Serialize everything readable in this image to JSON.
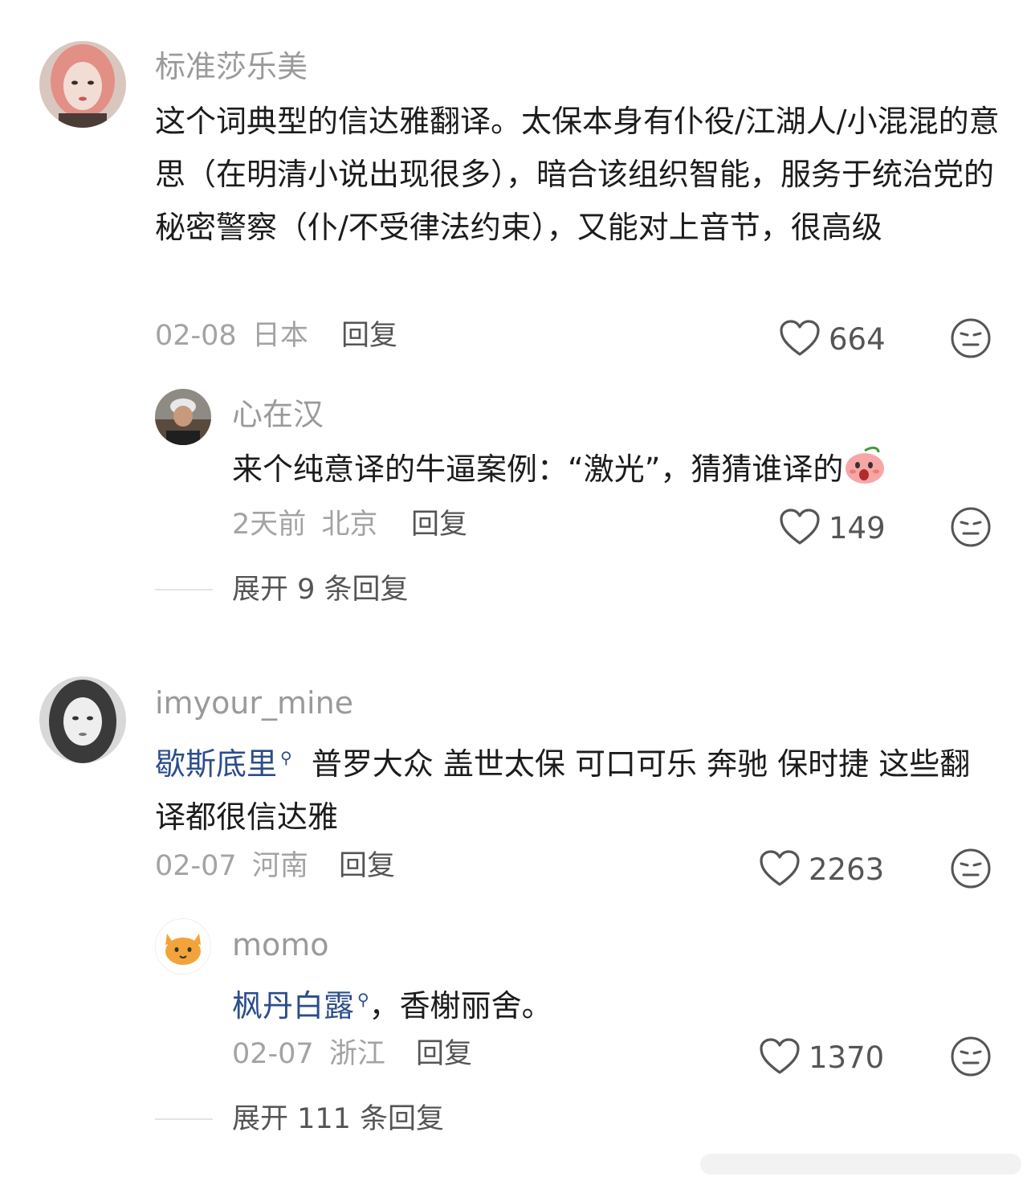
{
  "comments": [
    {
      "username": "标准莎乐美",
      "content": "这个词典型的信达雅翻译。太保本身有仆役/江湖人/小混混的意思（在明清小说出现很多），暗合该组织智能，服务于统治党的秘密警察（仆/不受律法约束），又能对上音节，很高级",
      "date": "02-08",
      "location": "日本",
      "reply_label": "回复",
      "likes": "664",
      "replies": [
        {
          "username": "心在汉",
          "content": "来个纯意译的牛逼案例：“激光”，猜猜谁译的",
          "date": "2天前",
          "location": "北京",
          "reply_label": "回复",
          "likes": "149"
        }
      ],
      "expand_label": "展开 9 条回复"
    },
    {
      "username": "imyour_mine",
      "tag": "歇斯底里",
      "content": "普罗大众 盖世太保 可口可乐 奔驰 保时捷 这些翻译都很信达雅",
      "date": "02-07",
      "location": "河南",
      "reply_label": "回复",
      "likes": "2263",
      "replies": [
        {
          "username": "momo",
          "tag": "枫丹白露",
          "content": "，香榭丽舍。",
          "date": "02-07",
          "location": "浙江",
          "reply_label": "回复",
          "likes": "1370"
        }
      ],
      "expand_label": "展开 111 条回复"
    }
  ],
  "icons": {
    "like": "heart-outline-icon",
    "dislike": "neutral-face-icon",
    "search_tag": "search-small-icon",
    "emoji": "surprised-peach-emoji",
    "cat_avatar": "cat-face-icon"
  },
  "colors": {
    "username": "#9a9a9a",
    "text": "#1c1c1c",
    "meta": "#a3a3a3",
    "tag_link": "#2b4d8c",
    "icon": "#555555"
  }
}
